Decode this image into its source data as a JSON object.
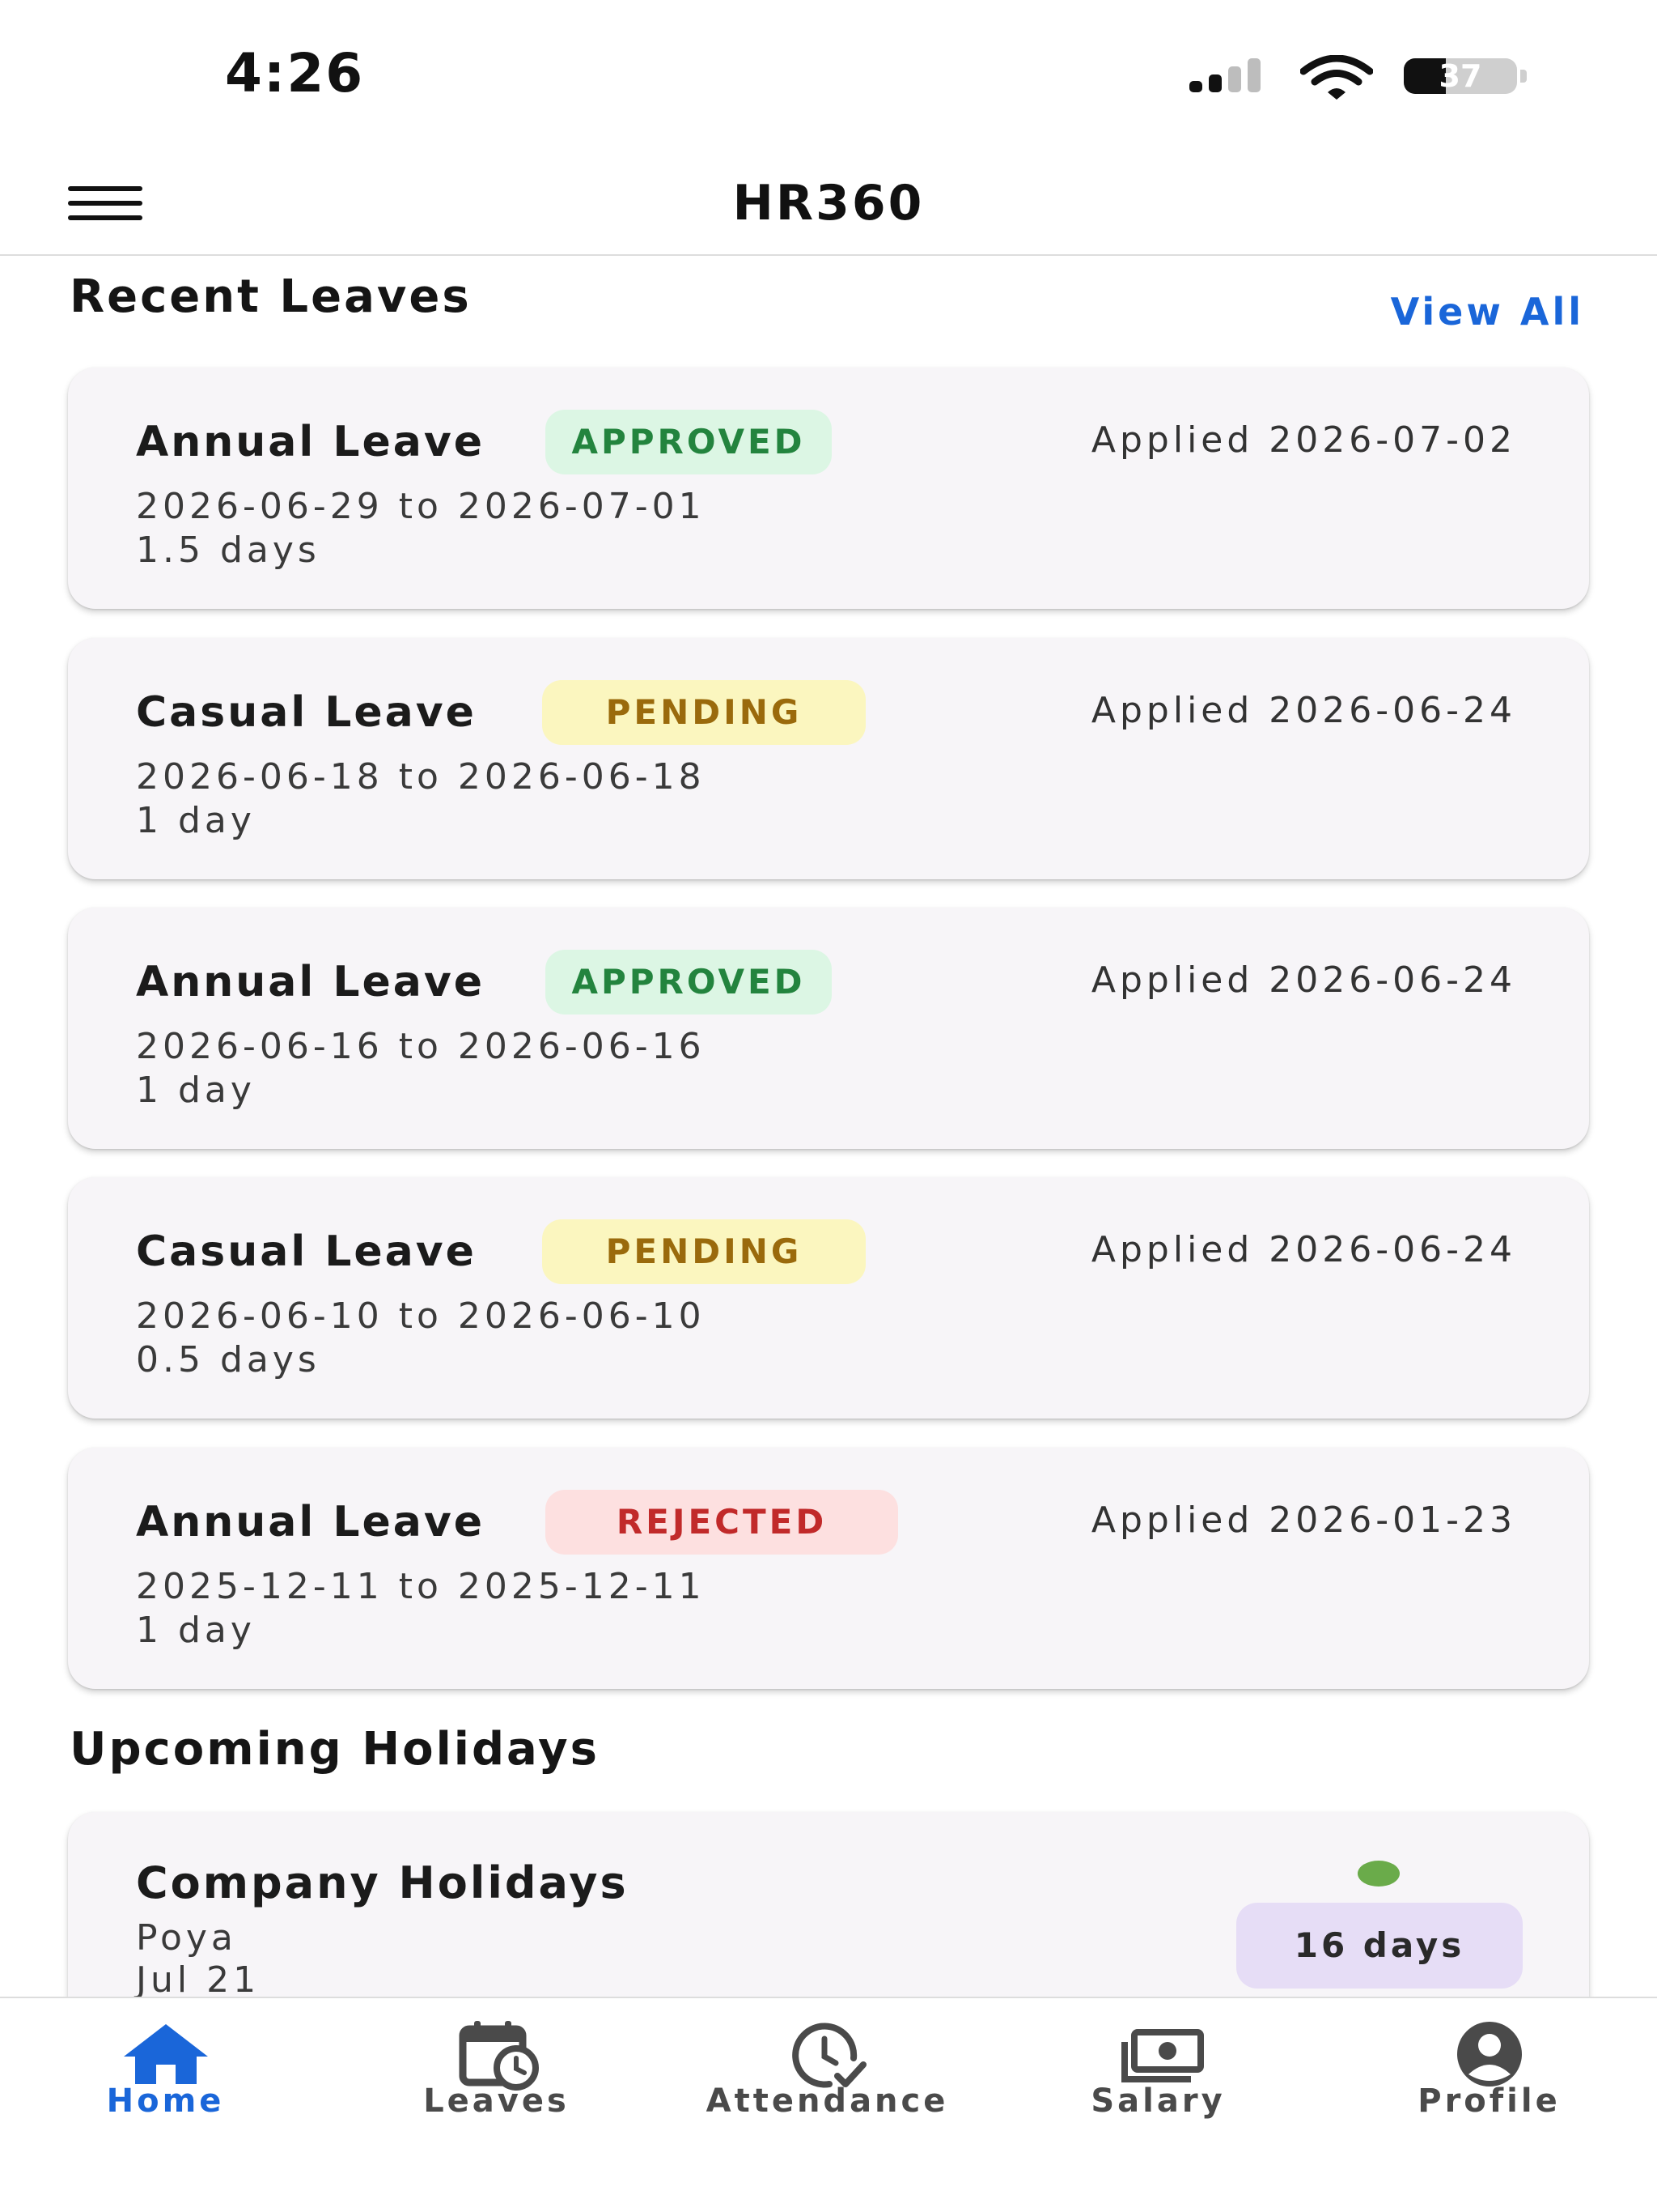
{
  "status_bar": {
    "time": "4:26",
    "battery": "37"
  },
  "app_bar": {
    "title": "HR360",
    "menu_icon": "hamburger-menu-icon"
  },
  "recent_leaves": {
    "title": "Recent Leaves",
    "view_all": "View All",
    "items": [
      {
        "type": "Annual Leave",
        "status": "APPROVED",
        "applied": "Applied 2026-07-02",
        "range": "2026-06-29 to 2026-07-01",
        "duration": "1.5 days"
      },
      {
        "type": "Casual Leave",
        "status": "PENDING",
        "applied": "Applied 2026-06-24",
        "range": "2026-06-18 to 2026-06-18",
        "duration": "1 day"
      },
      {
        "type": "Annual Leave",
        "status": "APPROVED",
        "applied": "Applied 2026-06-24",
        "range": "2026-06-16 to 2026-06-16",
        "duration": "1 day"
      },
      {
        "type": "Casual Leave",
        "status": "PENDING",
        "applied": "Applied 2026-06-24",
        "range": "2026-06-10 to 2026-06-10",
        "duration": "0.5 days"
      },
      {
        "type": "Annual Leave",
        "status": "REJECTED",
        "applied": "Applied 2026-01-23",
        "range": "2025-12-11 to 2025-12-11",
        "duration": "1 day"
      }
    ]
  },
  "upcoming_holidays": {
    "title": "Upcoming Holidays",
    "card": {
      "title": "Company Holidays",
      "name": "Poya",
      "date": "Jul 21",
      "days_left": "16 days"
    }
  },
  "bottom_nav": {
    "items": [
      {
        "label": "Home",
        "icon": "home-icon",
        "active": true
      },
      {
        "label": "Leaves",
        "icon": "calendar-clock-icon",
        "active": false
      },
      {
        "label": "Attendance",
        "icon": "clock-check-icon",
        "active": false
      },
      {
        "label": "Salary",
        "icon": "cash-icon",
        "active": false
      },
      {
        "label": "Profile",
        "icon": "account-circle-icon",
        "active": false
      }
    ]
  },
  "colors": {
    "accent": "#1a66d9",
    "approved_bg": "#dcf6e4",
    "approved_text": "#23843e",
    "pending_bg": "#fbf6bf",
    "pending_text": "#9a6a0c",
    "rejected_bg": "#fde0e0",
    "rejected_text": "#c12a2a",
    "card_bg": "#f7f5f8",
    "days_badge_bg": "#e6ddf6",
    "dot": "#6aab4a"
  }
}
